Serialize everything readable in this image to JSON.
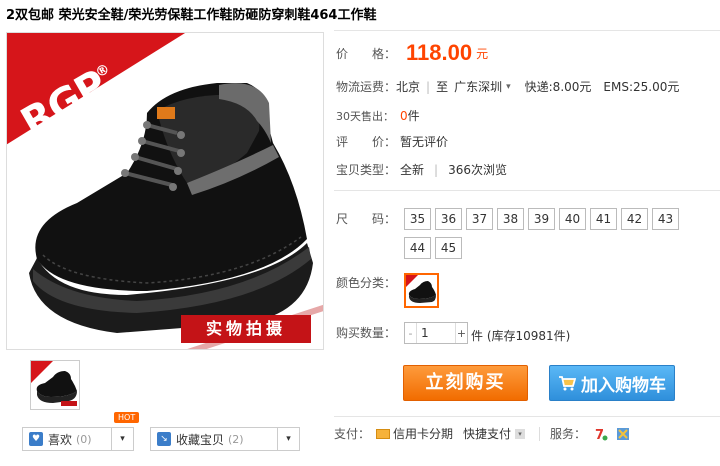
{
  "title": "2双包邮 荣光安全鞋/荣光劳保鞋工作鞋防砸防穿刺鞋464工作鞋",
  "image": {
    "brand_logo": "RGP",
    "brand_reg": "®",
    "photo_tag": "实物拍摄"
  },
  "price": {
    "label": "价　　格：",
    "value": "118.00",
    "unit": "元"
  },
  "shipping": {
    "label": "物流运费：",
    "from": "北京",
    "to_label": "至",
    "to": "广东深圳",
    "dropdown": "▾",
    "express": "快递:8.00元",
    "ems": "EMS:25.00元"
  },
  "sales": {
    "label": "30天售出：",
    "count": "0",
    "unit": "件"
  },
  "review": {
    "label": "评　　价：",
    "value": "暂无评价"
  },
  "type": {
    "label": "宝贝类型：",
    "condition": "全新",
    "views": "366次浏览"
  },
  "size": {
    "label": "尺　　码：",
    "options": [
      "35",
      "36",
      "37",
      "38",
      "39",
      "40",
      "41",
      "42",
      "43",
      "44",
      "45"
    ]
  },
  "color": {
    "label": "颜色分类："
  },
  "quantity": {
    "label": "购买数量：",
    "minus": "-",
    "value": "1",
    "plus": "+",
    "stock": "件 (库存10981件)"
  },
  "buttons": {
    "buy": "立刻购买",
    "cart": "加入购物车"
  },
  "social": {
    "hot": "HOT",
    "like": "喜欢",
    "like_count": "(0)",
    "fav": "收藏宝贝",
    "fav_count": "(2)",
    "arrow": "▾"
  },
  "payment": {
    "label": "支付：",
    "credit": "信用卡分期",
    "quick": "快捷支付",
    "service_label": "服务："
  },
  "colors": {
    "accent": "#ff4400",
    "buy": "#f16c00",
    "cart": "#2f8fdb",
    "brand": "#d6151a"
  }
}
